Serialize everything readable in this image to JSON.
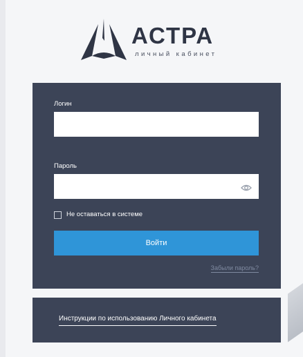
{
  "logo": {
    "title": "АСТРА",
    "subtitle": "личный кабинет"
  },
  "login_form": {
    "login_label": "Логин",
    "login_value": "",
    "password_label": "Пароль",
    "password_value": "",
    "remember_label": "Не оставаться в системе",
    "remember_checked": false,
    "submit_label": "Войти",
    "forgot_label": "Забыли пароль?"
  },
  "instructions": {
    "link_label": "Инструкции по использованию Личного кабинета"
  },
  "colors": {
    "panel": "#3c4457",
    "accent": "#2f95d8",
    "background": "#f5f6f8"
  }
}
